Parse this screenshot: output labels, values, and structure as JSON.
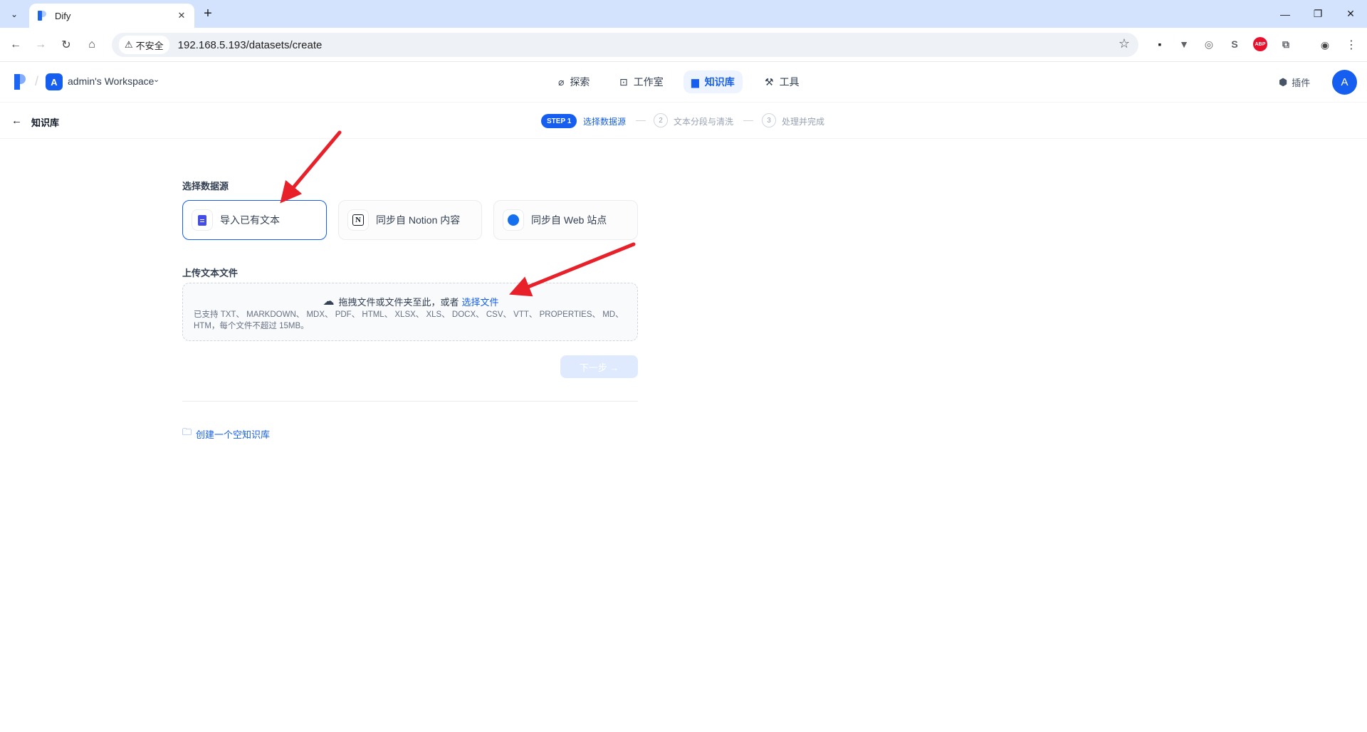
{
  "browser": {
    "tab_title": "Dify",
    "tab_close": "✕",
    "new_tab": "+",
    "security_label": "不安全",
    "url": "192.168.5.193/datasets/create",
    "extensions": [
      {
        "name": "extension-1",
        "color": "#1f1f1f",
        "glyph": "▪"
      },
      {
        "name": "extension-vue",
        "color": "#5f6368",
        "glyph": "▼"
      },
      {
        "name": "extension-circle",
        "color": "#5f6368",
        "glyph": "◎"
      },
      {
        "name": "extension-s",
        "color": "#5f6368",
        "glyph": "S"
      },
      {
        "name": "extension-abp",
        "color": "#e8112d",
        "glyph": "ABP"
      },
      {
        "name": "extension-puzzle",
        "color": "#5f6368",
        "glyph": "⧉"
      }
    ]
  },
  "header": {
    "workspace_initial": "A",
    "workspace_name": "admin's Workspace",
    "nav": [
      {
        "label": "探索",
        "icon": "compass-icon",
        "glyph": "⌀",
        "active": false
      },
      {
        "label": "工作室",
        "icon": "robot-icon",
        "glyph": "⊡",
        "active": false
      },
      {
        "label": "知识库",
        "icon": "book-icon",
        "glyph": "▆",
        "active": true
      },
      {
        "label": "工具",
        "icon": "tool-icon",
        "glyph": "⚒",
        "active": false
      }
    ],
    "plugins_label": "插件",
    "user_initial": "A"
  },
  "steps": {
    "back_label": "知识库",
    "step1_badge": "STEP 1",
    "step1_label": "选择数据源",
    "step2_num": "2",
    "step2_label": "文本分段与清洗",
    "step3_num": "3",
    "step3_label": "处理并完成"
  },
  "main": {
    "datasource_title": "选择数据源",
    "sources": [
      {
        "label": "导入已有文本",
        "icon": "document-icon",
        "selected": true
      },
      {
        "label": "同步自 Notion 内容",
        "icon": "notion-icon",
        "selected": false
      },
      {
        "label": "同步自 Web 站点",
        "icon": "web-icon",
        "selected": false
      }
    ],
    "upload_title": "上传文本文件",
    "dropzone_text": "拖拽文件或文件夹至此，或者",
    "dropzone_link": "选择文件",
    "supported_formats": "已支持 TXT、 MARKDOWN、 MDX、 PDF、 HTML、 XLSX、 XLS、 DOCX、 CSV、 VTT、 PROPERTIES、 MD、 HTM，每个文件不超过 15MB。",
    "next_button": "下一步 →",
    "create_empty": "创建一个空知识库"
  },
  "colors": {
    "accent": "#155eef",
    "annotation_arrow": "#e8202a"
  }
}
